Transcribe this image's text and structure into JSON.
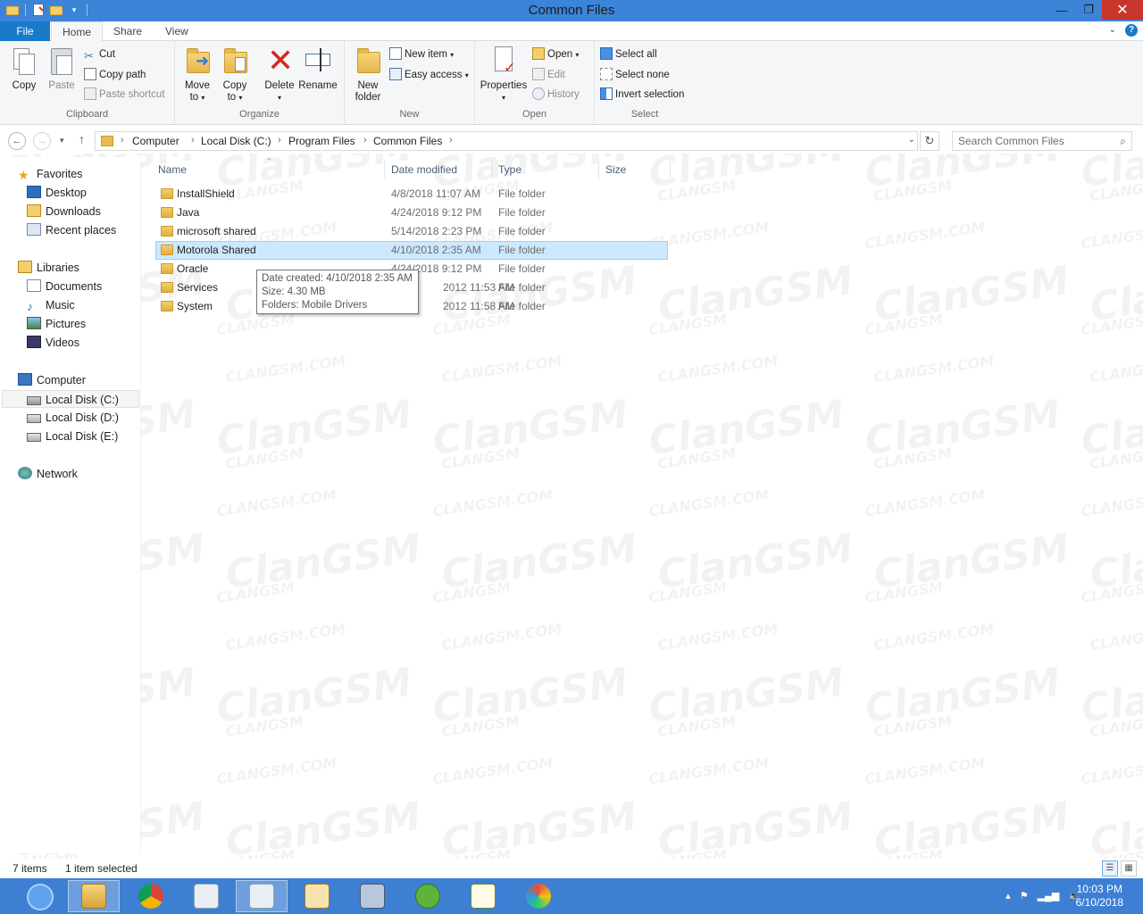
{
  "window": {
    "title": "Common Files"
  },
  "ribbon_tabs": [
    "File",
    "Home",
    "Share",
    "View"
  ],
  "ribbon": {
    "clipboard": {
      "label": "Clipboard",
      "copy": "Copy",
      "paste": "Paste",
      "cut": "Cut",
      "copy_path": "Copy path",
      "paste_shortcut": "Paste shortcut"
    },
    "organize": {
      "label": "Organize",
      "move_to_1": "Move",
      "move_to_2": "to",
      "copy_to_1": "Copy",
      "copy_to_2": "to",
      "delete": "Delete",
      "rename": "Rename"
    },
    "new": {
      "label": "New",
      "new_folder_1": "New",
      "new_folder_2": "folder",
      "new_item": "New item",
      "easy_access": "Easy access"
    },
    "open": {
      "label": "Open",
      "properties": "Properties",
      "open": "Open",
      "edit": "Edit",
      "history": "History"
    },
    "select": {
      "label": "Select",
      "select_all": "Select all",
      "select_none": "Select none",
      "invert_selection": "Invert selection"
    }
  },
  "address": {
    "crumbs": [
      "Computer",
      "Local Disk (C:)",
      "Program Files",
      "Common Files"
    ]
  },
  "search": {
    "placeholder": "Search Common Files"
  },
  "nav": {
    "favorites": "Favorites",
    "desktop": "Desktop",
    "downloads": "Downloads",
    "recent_places": "Recent places",
    "libraries": "Libraries",
    "documents": "Documents",
    "music": "Music",
    "pictures": "Pictures",
    "videos": "Videos",
    "computer": "Computer",
    "local_c": "Local Disk (C:)",
    "local_d": "Local Disk (D:)",
    "local_e": "Local Disk (E:)",
    "network": "Network"
  },
  "columns": {
    "name": "Name",
    "date_modified": "Date modified",
    "type": "Type",
    "size": "Size"
  },
  "files": [
    {
      "name": "InstallShield",
      "date": "4/8/2018 11:07 AM",
      "type": "File folder"
    },
    {
      "name": "Java",
      "date": "4/24/2018 9:12 PM",
      "type": "File folder"
    },
    {
      "name": "microsoft shared",
      "date": "5/14/2018 2:23 PM",
      "type": "File folder"
    },
    {
      "name": "Motorola Shared",
      "date": "4/10/2018 2:35 AM",
      "type": "File folder"
    },
    {
      "name": "Oracle",
      "date": "4/24/2018 9:12 PM",
      "type": "File folder"
    },
    {
      "name": "Services",
      "date": "2012 11:53 AM",
      "type": "File folder"
    },
    {
      "name": "System",
      "date": "2012 11:58 AM",
      "type": "File folder"
    }
  ],
  "tooltip": {
    "line1": "Date created: 4/10/2018 2:35 AM",
    "line2": "Size: 4.30 MB",
    "line3": "Folders: Mobile Drivers"
  },
  "status": {
    "items": "7 items",
    "selected": "1 item selected"
  },
  "taskbar": {
    "time": "10:03 PM",
    "date": "6/10/2018"
  },
  "watermark": {
    "big": "ClanGSM",
    "small": "CLANGSM",
    "url": "CLANGSM.COM"
  },
  "colors": {
    "titlebar": "#3b84d8",
    "file_tab": "#1979ca",
    "selection": "#cce8ff",
    "taskbar": "#3d7fd3",
    "close_button": "#c7352b"
  }
}
